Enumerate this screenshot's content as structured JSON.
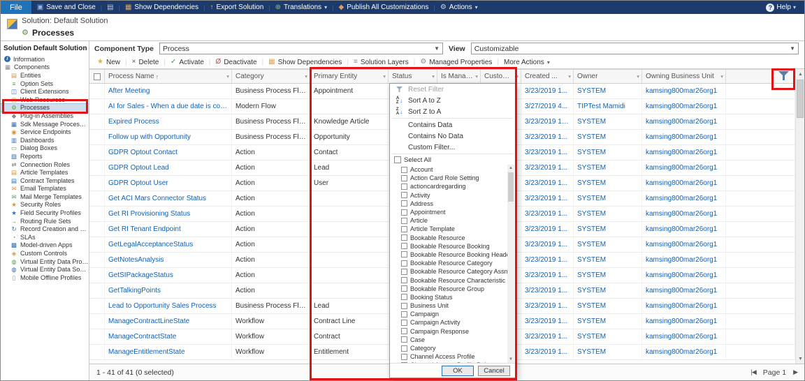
{
  "ribbon": {
    "file_label": "File",
    "help_label": "Help",
    "help_glyph": "?",
    "items": [
      {
        "label": "Save and Close",
        "icon": "save-icon",
        "glyph": "▣",
        "color": "#8fb4e3"
      },
      {
        "label": "",
        "icon": "print-icon",
        "glyph": "▤",
        "color": "#b9c4d2"
      },
      {
        "label": "Show Dependencies",
        "icon": "show-dependencies-icon",
        "glyph": "▦",
        "color": "#d9a65a"
      },
      {
        "label": "Export Solution",
        "icon": "export-solution-icon",
        "glyph": "↑",
        "color": "#e3c45a"
      },
      {
        "label": "Translations",
        "icon": "translations-icon",
        "glyph": "⊕",
        "color": "#7fc47f",
        "chevron": true
      },
      {
        "label": "Publish All Customizations",
        "icon": "publish-icon",
        "glyph": "◆",
        "color": "#e09a5a"
      },
      {
        "label": "Actions",
        "icon": "actions-icon",
        "glyph": "⚙",
        "color": "#c9d4e2",
        "chevron": true
      }
    ]
  },
  "header": {
    "solution_label": "Solution: Default Solution",
    "entity_label": "Processes"
  },
  "sidebar": {
    "title": "Solution Default Solution",
    "items": [
      {
        "label": "Information",
        "icon": "information-icon",
        "glyph": "i",
        "badge": true
      },
      {
        "label": "Components",
        "icon": "components-icon",
        "glyph": "▦",
        "color": "#8a8a8a"
      },
      {
        "label": "Entities",
        "icon": "entities-icon",
        "glyph": "▤",
        "color": "#cf9440",
        "indent": true
      },
      {
        "label": "Option Sets",
        "icon": "option-sets-icon",
        "glyph": "≡",
        "color": "#5a9e4f",
        "indent": true
      },
      {
        "label": "Client Extensions",
        "icon": "client-extensions-icon",
        "glyph": "◫",
        "color": "#2b6cb5",
        "indent": true
      },
      {
        "label": "Web Resources",
        "icon": "web-resources-icon",
        "glyph": "▢",
        "color": "#cf9440",
        "indent": true
      },
      {
        "label": "Processes",
        "icon": "processes-icon",
        "glyph": "⚙",
        "color": "#5a9e4f",
        "indent": true,
        "selected": true
      },
      {
        "label": "Plug-in Assemblies",
        "icon": "plugin-assemblies-icon",
        "glyph": "◆",
        "color": "#8a8a8a",
        "indent": true
      },
      {
        "label": "Sdk Message Processing St...",
        "icon": "sdk-message-processing-icon",
        "glyph": "▦",
        "color": "#2b6cb5",
        "indent": true
      },
      {
        "label": "Service Endpoints",
        "icon": "service-endpoints-icon",
        "glyph": "◉",
        "color": "#cf9440",
        "indent": true
      },
      {
        "label": "Dashboards",
        "icon": "dashboards-icon",
        "glyph": "▥",
        "color": "#2b6cb5",
        "indent": true
      },
      {
        "label": "Dialog Boxes",
        "icon": "dialog-boxes-icon",
        "glyph": "▭",
        "color": "#5a9e4f",
        "indent": true
      },
      {
        "label": "Reports",
        "icon": "reports-icon",
        "glyph": "▧",
        "color": "#2b6cb5",
        "indent": true
      },
      {
        "label": "Connection Roles",
        "icon": "connection-roles-icon",
        "glyph": "⇄",
        "color": "#8a8a8a",
        "indent": true
      },
      {
        "label": "Article Templates",
        "icon": "article-templates-icon",
        "glyph": "▤",
        "color": "#cf9440",
        "indent": true
      },
      {
        "label": "Contract Templates",
        "icon": "contract-templates-icon",
        "glyph": "▤",
        "color": "#2b6cb5",
        "indent": true
      },
      {
        "label": "Email Templates",
        "icon": "email-templates-icon",
        "glyph": "✉",
        "color": "#cf9440",
        "indent": true
      },
      {
        "label": "Mail Merge Templates",
        "icon": "mail-merge-templates-icon",
        "glyph": "✉",
        "color": "#5a9e4f",
        "indent": true
      },
      {
        "label": "Security Roles",
        "icon": "security-roles-icon",
        "glyph": "★",
        "color": "#cf9440",
        "indent": true
      },
      {
        "label": "Field Security Profiles",
        "icon": "field-security-profiles-icon",
        "glyph": "★",
        "color": "#2b6cb5",
        "indent": true
      },
      {
        "label": "Routing Rule Sets",
        "icon": "routing-rule-sets-icon",
        "glyph": "→",
        "color": "#5a9e4f",
        "indent": true
      },
      {
        "label": "Record Creation and Upda...",
        "icon": "record-creation-icon",
        "glyph": "↻",
        "color": "#2b6cb5",
        "indent": true
      },
      {
        "label": "SLAs",
        "icon": "slas-icon",
        "glyph": "◔",
        "color": "#8a8a8a",
        "indent": true
      },
      {
        "label": "Model-driven Apps",
        "icon": "model-driven-apps-icon",
        "glyph": "▩",
        "color": "#2b6cb5",
        "indent": true
      },
      {
        "label": "Custom Controls",
        "icon": "custom-controls-icon",
        "glyph": "◈",
        "color": "#cf9440",
        "indent": true
      },
      {
        "label": "Virtual Entity Data Providers",
        "icon": "virtual-entity-data-providers-icon",
        "glyph": "◍",
        "color": "#5a9e4f",
        "indent": true
      },
      {
        "label": "Virtual Entity Data Sources",
        "icon": "virtual-entity-data-sources-icon",
        "glyph": "◍",
        "color": "#2b6cb5",
        "indent": true
      },
      {
        "label": "Mobile Offline Profiles",
        "icon": "mobile-offline-profiles-icon",
        "glyph": "▯",
        "color": "#8a8a8a",
        "indent": true
      }
    ]
  },
  "main": {
    "component_type_label": "Component Type",
    "component_type_value": "Process",
    "view_label": "View",
    "view_value": "Customizable",
    "toolbar": [
      {
        "label": "New",
        "icon": "new-icon",
        "glyph": "★",
        "color": "#e0b43a"
      },
      {
        "label": "Delete",
        "icon": "delete-icon",
        "glyph": "×",
        "color": "#555555"
      },
      {
        "label": "Activate",
        "icon": "activate-icon",
        "glyph": "✓",
        "color": "#3f8f3f"
      },
      {
        "label": "Deactivate",
        "icon": "deactivate-icon",
        "glyph": "Ø",
        "color": "#b05050"
      },
      {
        "label": "Show Dependencies",
        "icon": "show-dependencies-icon",
        "glyph": "▦",
        "color": "#d9a65a"
      },
      {
        "label": "Solution Layers",
        "icon": "solution-layers-icon",
        "glyph": "≡",
        "color": "#7a8da0"
      },
      {
        "label": "Managed Properties",
        "icon": "managed-properties-icon",
        "glyph": "⚙",
        "color": "#7a8da0"
      },
      {
        "label": "More Actions",
        "icon": "",
        "chevron": true
      }
    ],
    "grid": {
      "columns": [
        {
          "label": "Process Name",
          "sort": "asc"
        },
        {
          "label": "Category"
        },
        {
          "label": "Primary Entity"
        },
        {
          "label": "Status"
        },
        {
          "label": "Is Manag..."
        },
        {
          "label": "Customizable"
        },
        {
          "label": "Created ..."
        },
        {
          "label": "Owner"
        },
        {
          "label": "Owning Business Unit"
        }
      ],
      "rows": [
        {
          "name": "After Meeting",
          "category": "Business Process Flow",
          "entity": "Appointment",
          "created": "3/23/2019 1...",
          "owner": "SYSTEM",
          "unit": "kamsing800mar26org1"
        },
        {
          "name": "AI for Sales - When a due date is coming up",
          "category": "Modern Flow",
          "entity": "",
          "created": "3/27/2019 4...",
          "owner": "TIPTest Mamidi",
          "unit": "kamsing800mar26org1"
        },
        {
          "name": "Expired Process",
          "category": "Business Process Flow",
          "entity": "Knowledge Article",
          "created": "3/23/2019 12...",
          "owner": "SYSTEM",
          "unit": "kamsing800mar26org1"
        },
        {
          "name": "Follow up with Opportunity",
          "category": "Business Process Flow",
          "entity": "Opportunity",
          "created": "3/23/2019 1...",
          "owner": "SYSTEM",
          "unit": "kamsing800mar26org1"
        },
        {
          "name": "GDPR Optout Contact",
          "category": "Action",
          "entity": "Contact",
          "created": "3/23/2019 1...",
          "owner": "SYSTEM",
          "unit": "kamsing800mar26org1"
        },
        {
          "name": "GDPR Optout Lead",
          "category": "Action",
          "entity": "Lead",
          "created": "3/23/2019 1...",
          "owner": "SYSTEM",
          "unit": "kamsing800mar26org1"
        },
        {
          "name": "GDPR Optout User",
          "category": "Action",
          "entity": "User",
          "created": "3/23/2019 1...",
          "owner": "SYSTEM",
          "unit": "kamsing800mar26org1"
        },
        {
          "name": "Get ACI Mars Connector Status",
          "category": "Action",
          "entity": "",
          "created": "3/23/2019 1...",
          "owner": "SYSTEM",
          "unit": "kamsing800mar26org1"
        },
        {
          "name": "Get RI Provisioning Status",
          "category": "Action",
          "entity": "",
          "created": "3/23/2019 1...",
          "owner": "SYSTEM",
          "unit": "kamsing800mar26org1"
        },
        {
          "name": "Get RI Tenant Endpoint",
          "category": "Action",
          "entity": "",
          "created": "3/23/2019 1...",
          "owner": "SYSTEM",
          "unit": "kamsing800mar26org1"
        },
        {
          "name": "GetLegalAcceptanceStatus",
          "category": "Action",
          "entity": "",
          "created": "3/23/2019 1...",
          "owner": "SYSTEM",
          "unit": "kamsing800mar26org1"
        },
        {
          "name": "GetNotesAnalysis",
          "category": "Action",
          "entity": "",
          "created": "3/23/2019 1...",
          "owner": "SYSTEM",
          "unit": "kamsing800mar26org1"
        },
        {
          "name": "GetSIPackageStatus",
          "category": "Action",
          "entity": "",
          "created": "3/23/2019 1...",
          "owner": "SYSTEM",
          "unit": "kamsing800mar26org1"
        },
        {
          "name": "GetTalkingPoints",
          "category": "Action",
          "entity": "",
          "created": "3/23/2019 1...",
          "owner": "SYSTEM",
          "unit": "kamsing800mar26org1"
        },
        {
          "name": "Lead to Opportunity Sales Process",
          "category": "Business Process Flow",
          "entity": "Lead",
          "created": "3/23/2019 1...",
          "owner": "SYSTEM",
          "unit": "kamsing800mar26org1"
        },
        {
          "name": "ManageContractLineState",
          "category": "Workflow",
          "entity": "Contract Line",
          "created": "3/23/2019 1...",
          "owner": "SYSTEM",
          "unit": "kamsing800mar26org1"
        },
        {
          "name": "ManageContractState",
          "category": "Workflow",
          "entity": "Contract",
          "created": "3/23/2019 1...",
          "owner": "SYSTEM",
          "unit": "kamsing800mar26org1"
        },
        {
          "name": "ManageEntitlementState",
          "category": "Workflow",
          "entity": "Entitlement",
          "created": "3/23/2019 1...",
          "owner": "SYSTEM",
          "unit": "kamsing800mar26org1"
        }
      ]
    },
    "status_bar": {
      "count_text": "1 - 41 of 41 (0 selected)",
      "page_label": "Page 1"
    }
  },
  "filter_menu": {
    "sort_items": [
      {
        "label": "Reset Filter",
        "icon": "reset-filter-icon",
        "disabled": true
      },
      {
        "label": "Sort A to Z",
        "icon": "sort-az-icon"
      },
      {
        "label": "Sort Z to A",
        "icon": "sort-za-icon"
      }
    ],
    "filter_items": [
      {
        "label": "Contains Data"
      },
      {
        "label": "Contains No Data"
      },
      {
        "label": "Custom Filter..."
      }
    ],
    "select_all_label": "Select All",
    "options": [
      "Account",
      "Action Card Role Setting",
      "actioncardregarding",
      "Activity",
      "Address",
      "Appointment",
      "Article",
      "Article Template",
      "Bookable Resource",
      "Bookable Resource Booking",
      "Bookable Resource Booking Header",
      "Bookable Resource Category",
      "Bookable Resource Category Assn",
      "Bookable Resource Characteristic",
      "Bookable Resource Group",
      "Booking Status",
      "Business Unit",
      "Campaign",
      "Campaign Activity",
      "Campaign Response",
      "Case",
      "Category",
      "Channel Access Profile",
      "Channel Access Profile Rule"
    ],
    "ok_label": "OK",
    "cancel_label": "Cancel"
  },
  "annotations": {
    "color": "#e01414",
    "items": [
      "processes-sidebar-highlight",
      "filter-menu-highlight",
      "filter-icon-highlight"
    ]
  }
}
